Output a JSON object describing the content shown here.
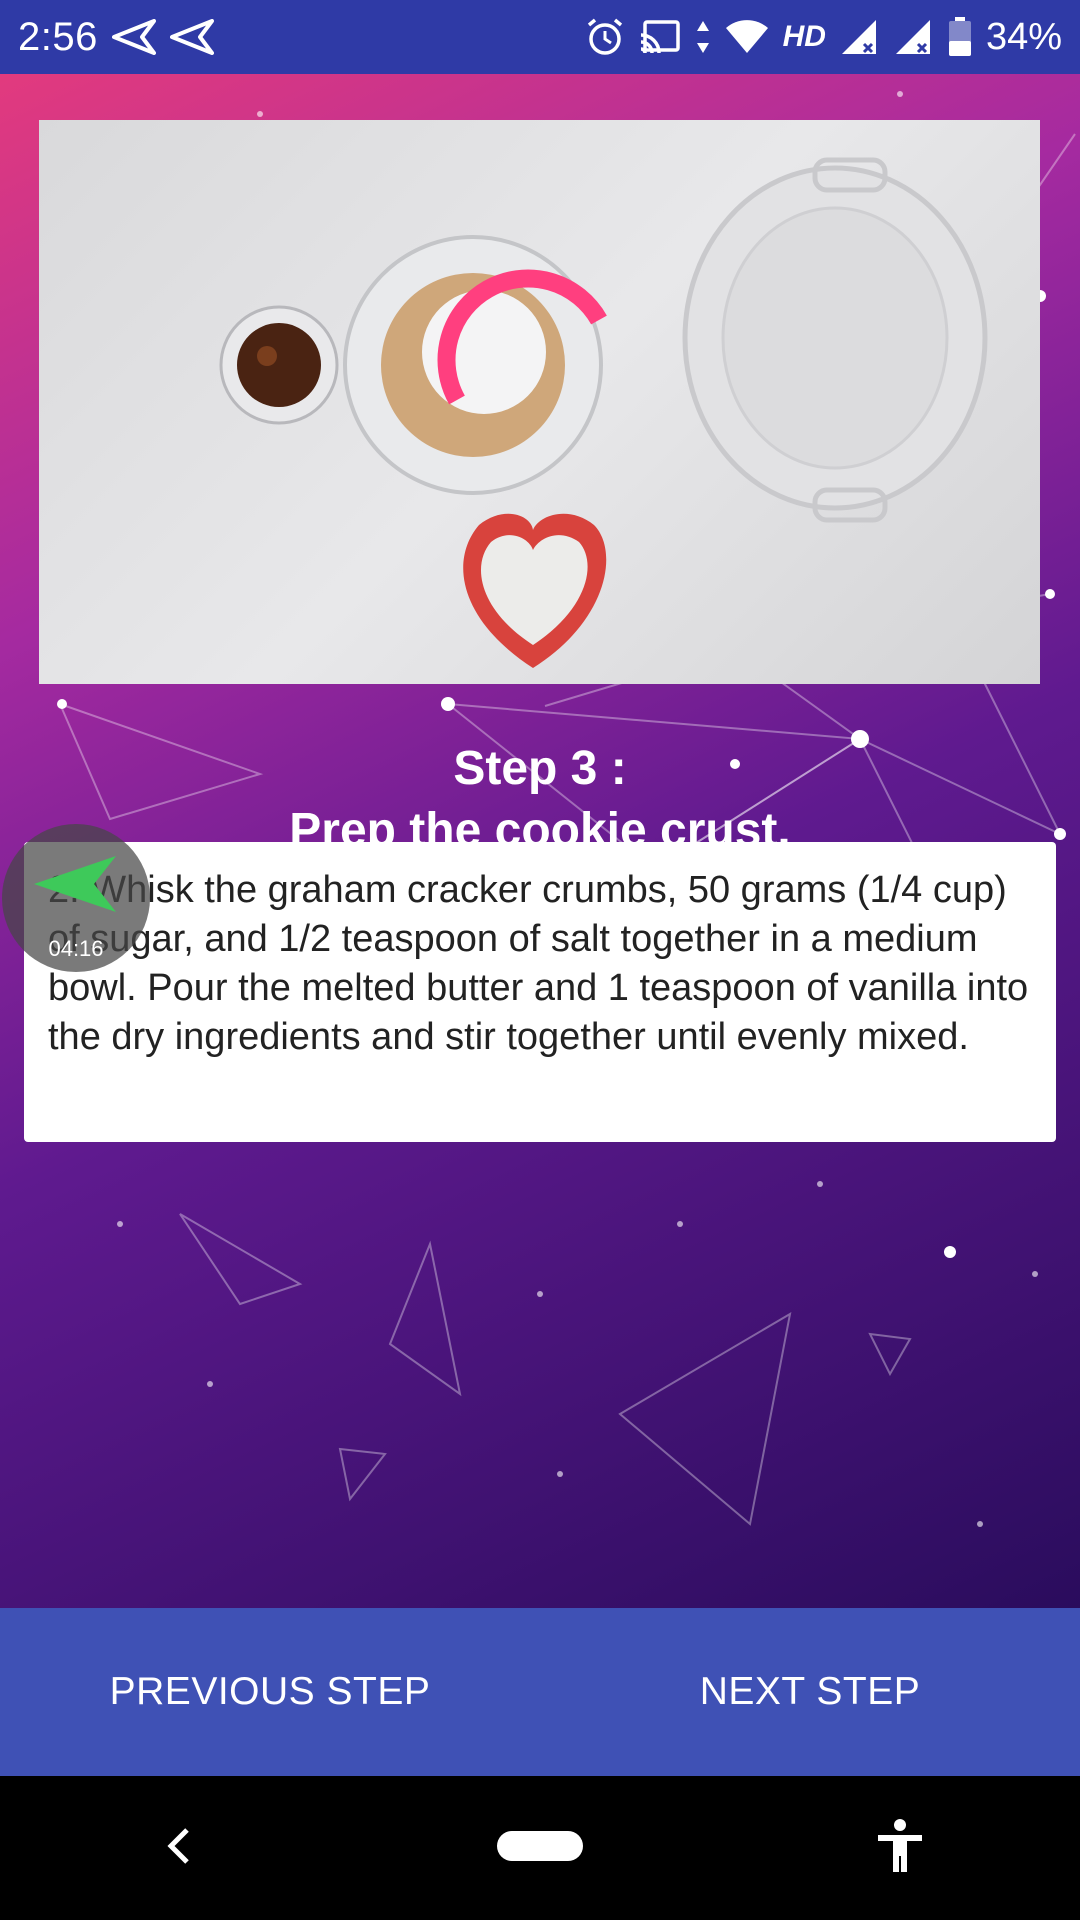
{
  "status_bar": {
    "time": "2:56",
    "hd_label": "HD",
    "battery_percent": "34%",
    "icons": [
      "send-icon",
      "send-icon",
      "alarm-icon",
      "cast-icon",
      "data-arrows-icon",
      "wifi-icon",
      "signal-icon",
      "signal-icon",
      "battery-icon"
    ]
  },
  "video": {
    "content": "video-frame",
    "loading_spinner_color": "#ff3f7f"
  },
  "step": {
    "title": "Step 3 :",
    "subtitle": "Prep the cookie crust."
  },
  "description": {
    "text": "2. Whisk the graham cracker crumbs, 50 grams (1/4 cup) of sugar, and 1/2 teaspoon of salt together in a medium bowl. Pour the melted butter and 1 teaspoon of vanilla into the dry ingredients and stir together until evenly mixed."
  },
  "floating_timer": {
    "time": "04:16",
    "icon": "send-icon",
    "icon_color": "#3ec95a"
  },
  "actions": {
    "previous_label": "PREVIOUS STEP",
    "next_label": "NEXT STEP"
  },
  "nav": {
    "icons": [
      "back-icon",
      "home-icon",
      "accessibility-icon"
    ]
  },
  "colors": {
    "status_bar": "#2f3aa6",
    "action_bar": "#3f51b5",
    "gradient_top": "#e23a7e",
    "gradient_bottom": "#2a0c5d"
  }
}
